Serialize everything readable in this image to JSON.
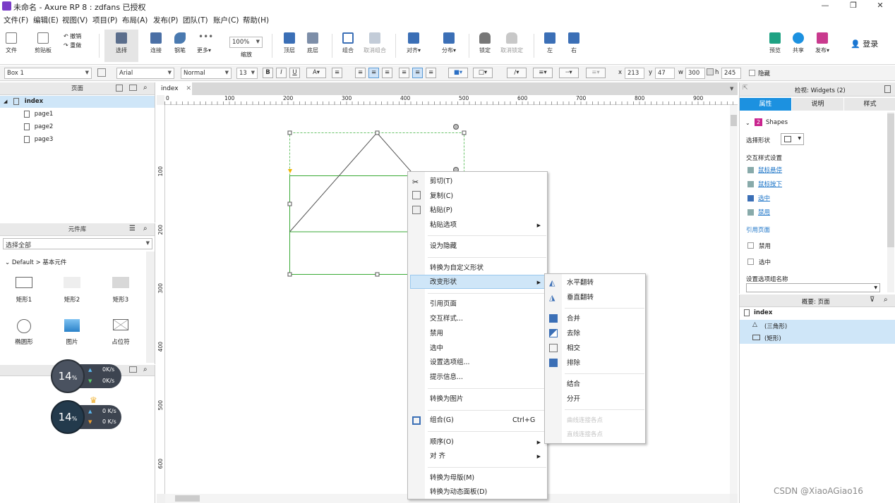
{
  "window": {
    "title": "未命名 - Axure RP 8 : zdfans 已授权",
    "min": "—",
    "max": "❐",
    "close": "✕"
  },
  "menu": [
    "文件(F)",
    "编辑(E)",
    "视图(V)",
    "项目(P)",
    "布局(A)",
    "发布(P)",
    "团队(T)",
    "账户(C)",
    "帮助(H)"
  ],
  "toolbar": {
    "file": "文件",
    "clipboard": "剪贴板",
    "undo": "撤销",
    "redo": "重做",
    "select": "选择",
    "connect": "连接",
    "pen": "钢笔",
    "more": "更多▾",
    "zoom_value": "100%",
    "zoom_label": "缩放",
    "front": "顶层",
    "back": "底层",
    "group": "组合",
    "ungroup": "取消组合",
    "align": "对齐▾",
    "distribute": "分布▾",
    "lock": "锁定",
    "unlock": "取消锁定",
    "left": "左",
    "right": "右",
    "preview": "预览",
    "share": "共享",
    "publish": "发布▾",
    "login": "登录"
  },
  "format": {
    "widget_name": "Box 1",
    "font": "Arial",
    "style": "Normal",
    "size": "13",
    "bold": "B",
    "italic": "I",
    "underline": "U",
    "x_label": "x",
    "x": "213",
    "y_label": "y",
    "y": "47",
    "w_label": "w",
    "w": "300",
    "h_label": "h",
    "h": "245",
    "hidden_label": "隐藏"
  },
  "pages_panel": {
    "title": "页面",
    "root": "index",
    "pages": [
      "page1",
      "page2",
      "page3"
    ]
  },
  "library_panel": {
    "title": "元件库",
    "filter": "选择全部",
    "group": "Default > 基本元件",
    "items": [
      "矩形1",
      "矩形2",
      "矩形3",
      "椭圆形",
      "图片",
      "占位符"
    ]
  },
  "masters_speed": [
    {
      "percent": "14",
      "unit": "%",
      "up": "0",
      "down": "0",
      "rate_unit": "K/s"
    },
    {
      "percent": "14",
      "unit": "%",
      "up": "0",
      "down": "0",
      "rate_unit": "K/s"
    }
  ],
  "canvas": {
    "tab": "index",
    "ruler_h": [
      "0",
      "100",
      "200",
      "300",
      "400",
      "500",
      "600",
      "700",
      "800",
      "900"
    ],
    "ruler_v": [
      "100",
      "200",
      "300",
      "400",
      "500",
      "600"
    ]
  },
  "context_menu": {
    "items": [
      "剪切(T)",
      "复制(C)",
      "粘贴(P)",
      "粘贴选项",
      "设为隐藏",
      "转换为自定义形状",
      "改变形状",
      "引用页面",
      "交互样式...",
      "禁用",
      "选中",
      "设置选项组...",
      "提示信息...",
      "转换为图片",
      "组合(G)",
      "顺序(O)",
      "对 齐",
      "转换为母版(M)",
      "转换为动态面板(D)"
    ],
    "group_shortcut": "Ctrl+G"
  },
  "submenu": {
    "items": [
      "水平翻转",
      "垂直翻转",
      "合并",
      "去除",
      "相交",
      "排除",
      "结合",
      "分开",
      "曲线连接各点",
      "直线连接各点"
    ]
  },
  "inspector": {
    "title": "检视: Widgets (2)",
    "tabs": [
      "属性",
      "说明",
      "样式"
    ],
    "shapes_count": "2",
    "shapes_label": "Shapes",
    "select_shape": "选择形状",
    "interaction_title": "交互样式设置",
    "hover": "鼠标悬停",
    "mousedown": "鼠标按下",
    "selected": "选中",
    "disabled": "禁用",
    "ref_page": "引用页面",
    "chk_disabled": "禁用",
    "chk_selected": "选中",
    "option_group": "设置选项组名称"
  },
  "outline": {
    "title": "概要: 页面",
    "root": "index",
    "items": [
      "(三角形)",
      "(矩形)"
    ]
  },
  "watermark": "CSDN @XiaoAGiao16",
  "colors": {
    "accent": "#1c91e0",
    "selection": "#cfe6f8",
    "shape_green": "#3aaa35"
  }
}
